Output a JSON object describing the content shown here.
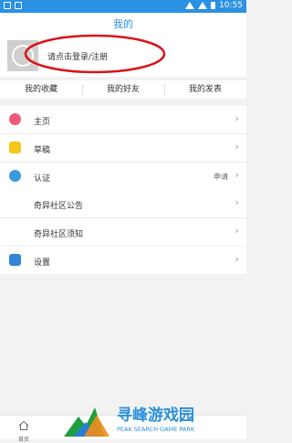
{
  "status_bar": {
    "time": "10:55"
  },
  "header": {
    "title": "我的"
  },
  "profile": {
    "login_text": "请点击登录/注册"
  },
  "tabs": [
    "我的收藏",
    "我的好友",
    "我的发表"
  ],
  "menu_group1": [
    {
      "label": "主页",
      "icon": "home-icon",
      "color": "#f0597a"
    },
    {
      "label": "草稿",
      "icon": "draft-icon",
      "color": "#f5c518"
    },
    {
      "label": "认证",
      "icon": "verify-icon",
      "color": "#3a9bdc",
      "extra": "申请"
    }
  ],
  "menu_group2": [
    {
      "label": "奇异社区公告"
    },
    {
      "label": "奇异社区须知"
    }
  ],
  "menu_group3": [
    {
      "label": "设置",
      "icon": "settings-icon",
      "color": "#2f86d6"
    }
  ],
  "bottom_nav": {
    "home_label": "首页"
  },
  "watermark": {
    "title": "寻峰游戏园",
    "subtitle": "PEAK SEARCH GAME PARK"
  }
}
